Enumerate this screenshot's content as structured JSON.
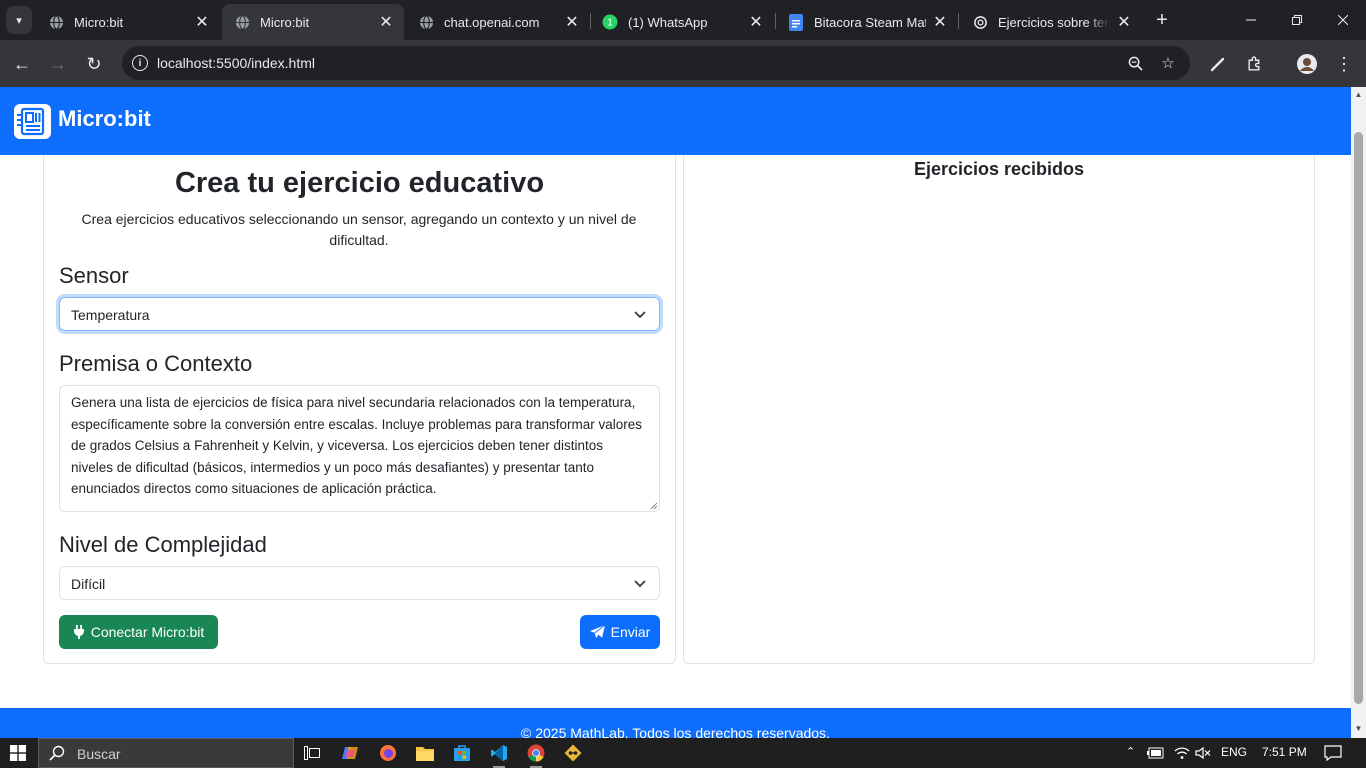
{
  "browser": {
    "tabs": [
      {
        "title": "Micro:bit",
        "icon": "globe-icon",
        "active": false
      },
      {
        "title": "Micro:bit",
        "icon": "globe-icon",
        "active": true
      },
      {
        "title": "chat.openai.com",
        "icon": "globe-icon",
        "active": false
      },
      {
        "title": "(1) WhatsApp",
        "icon": "whatsapp-icon",
        "active": false
      },
      {
        "title": "Bitacora Steam Math",
        "icon": "docs-icon",
        "active": false
      },
      {
        "title": "Ejercicios sobre temp",
        "icon": "openai-icon",
        "active": false
      }
    ],
    "url": "localhost:5500/index.html"
  },
  "navbar": {
    "brand": "Micro:bit",
    "color": "#0d6efd"
  },
  "form": {
    "title": "Crea tu ejercicio educativo",
    "description": "Crea ejercicios educativos seleccionando un sensor, agregando un contexto y un nivel de dificultad.",
    "sensor_label": "Sensor",
    "sensor_value": "Temperatura",
    "context_label": "Premisa o Contexto",
    "context_value": "Genera una lista de ejercicios de física para nivel secundaria relacionados con la temperatura, específicamente sobre la conversión entre escalas. Incluye problemas para transformar valores de grados Celsius a Fahrenheit y Kelvin, y viceversa. Los ejercicios deben tener distintos niveles de dificultad (básicos, intermedios y un poco más desafiantes) y presentar tanto enunciados directos como situaciones de aplicación práctica.",
    "complexity_label": "Nivel de Complejidad",
    "complexity_value": "Difícil",
    "connect_button": "Conectar Micro:bit",
    "send_button": "Enviar"
  },
  "results": {
    "title": "Ejercicios recibidos"
  },
  "footer": {
    "text": "© 2025 MathLab. Todos los derechos reservados."
  },
  "taskbar": {
    "search_placeholder": "Buscar",
    "language": "ENG",
    "time": "7:51 PM"
  }
}
